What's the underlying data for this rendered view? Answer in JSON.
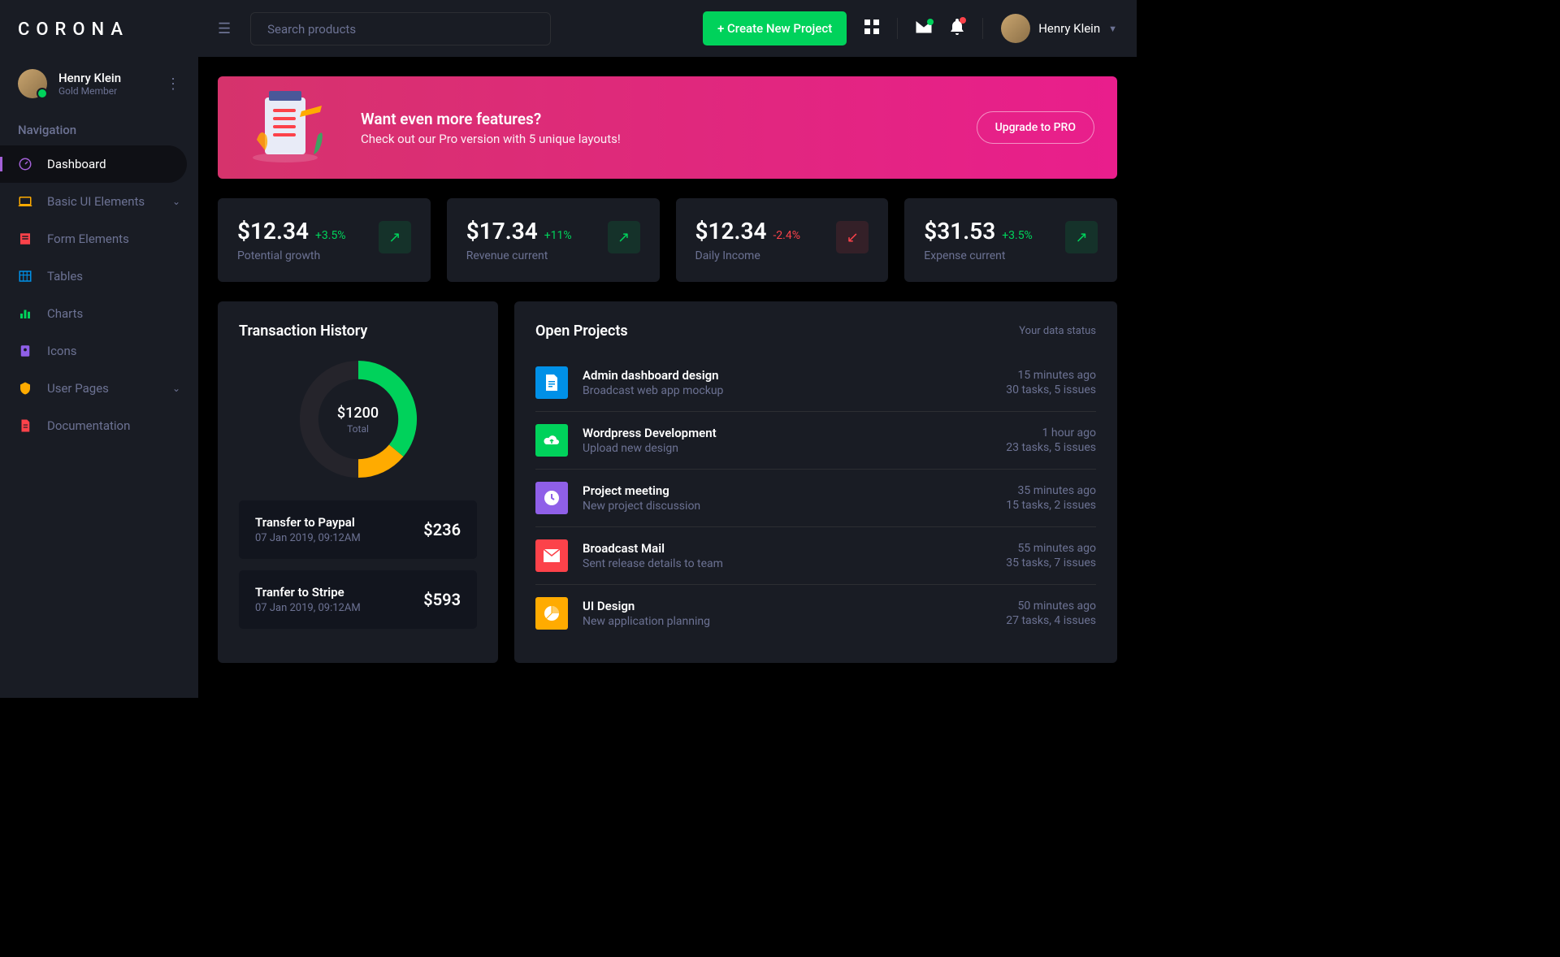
{
  "brand": "CORONA",
  "user": {
    "name": "Henry Klein",
    "role": "Gold Member"
  },
  "sidebar": {
    "heading": "Navigation",
    "items": [
      {
        "label": "Dashboard",
        "icon": "speedometer",
        "active": true
      },
      {
        "label": "Basic UI Elements",
        "icon": "laptop",
        "expandable": true
      },
      {
        "label": "Form Elements",
        "icon": "form"
      },
      {
        "label": "Tables",
        "icon": "table"
      },
      {
        "label": "Charts",
        "icon": "chart"
      },
      {
        "label": "Icons",
        "icon": "contacts"
      },
      {
        "label": "User Pages",
        "icon": "security",
        "expandable": true
      },
      {
        "label": "Documentation",
        "icon": "document"
      }
    ]
  },
  "topbar": {
    "search_placeholder": "Search products",
    "create_label": "+ Create New Project",
    "username": "Henry Klein"
  },
  "promo": {
    "title": "Want even more features?",
    "subtitle": "Check out our Pro version with 5 unique layouts!",
    "button": "Upgrade to PRO"
  },
  "stats": [
    {
      "value": "$12.34",
      "change": "+3.5%",
      "dir": "up",
      "label": "Potential growth"
    },
    {
      "value": "$17.34",
      "change": "+11%",
      "dir": "up",
      "label": "Revenue current"
    },
    {
      "value": "$12.34",
      "change": "-2.4%",
      "dir": "down",
      "label": "Daily Income"
    },
    {
      "value": "$31.53",
      "change": "+3.5%",
      "dir": "up",
      "label": "Expense current"
    }
  ],
  "transactions": {
    "title": "Transaction History",
    "donut": {
      "value": "$1200",
      "label": "Total"
    },
    "items": [
      {
        "title": "Transfer to Paypal",
        "date": "07 Jan 2019, 09:12AM",
        "amount": "$236"
      },
      {
        "title": "Tranfer to Stripe",
        "date": "07 Jan 2019, 09:12AM",
        "amount": "$593"
      }
    ]
  },
  "projects": {
    "title": "Open Projects",
    "status": "Your data status",
    "items": [
      {
        "title": "Admin dashboard design",
        "sub": "Broadcast web app mockup",
        "time": "15 minutes ago",
        "tasks": "30 tasks, 5 issues",
        "color": "#0090e7",
        "icon": "file"
      },
      {
        "title": "Wordpress Development",
        "sub": "Upload new design",
        "time": "1 hour ago",
        "tasks": "23 tasks, 5 issues",
        "color": "#00d25b",
        "icon": "cloud"
      },
      {
        "title": "Project meeting",
        "sub": "New project discussion",
        "time": "35 minutes ago",
        "tasks": "15 tasks, 2 issues",
        "color": "#8f5fe8",
        "icon": "clock"
      },
      {
        "title": "Broadcast Mail",
        "sub": "Sent release details to team",
        "time": "55 minutes ago",
        "tasks": "35 tasks, 7 issues",
        "color": "#fc424a",
        "icon": "mail"
      },
      {
        "title": "UI Design",
        "sub": "New application planning",
        "time": "50 minutes ago",
        "tasks": "27 tasks, 4 issues",
        "color": "#ffab00",
        "icon": "pie"
      }
    ]
  },
  "chart_data": {
    "type": "pie",
    "title": "Transaction History",
    "total_label": "Total",
    "total_value": "$1200",
    "series": [
      {
        "name": "Segment A",
        "value": 36,
        "color": "#00d25b"
      },
      {
        "name": "Segment B",
        "value": 14,
        "color": "#ffab00"
      },
      {
        "name": "Remainder",
        "value": 50,
        "color": "#25242b"
      }
    ]
  },
  "colors": {
    "icons": {
      "speedometer": "#a461d8",
      "laptop": "#ffab00",
      "form": "#fc424a",
      "table": "#0090e7",
      "chart": "#00d25b",
      "contacts": "#8f5fe8",
      "security": "#ffab00",
      "document": "#fc424a"
    }
  }
}
